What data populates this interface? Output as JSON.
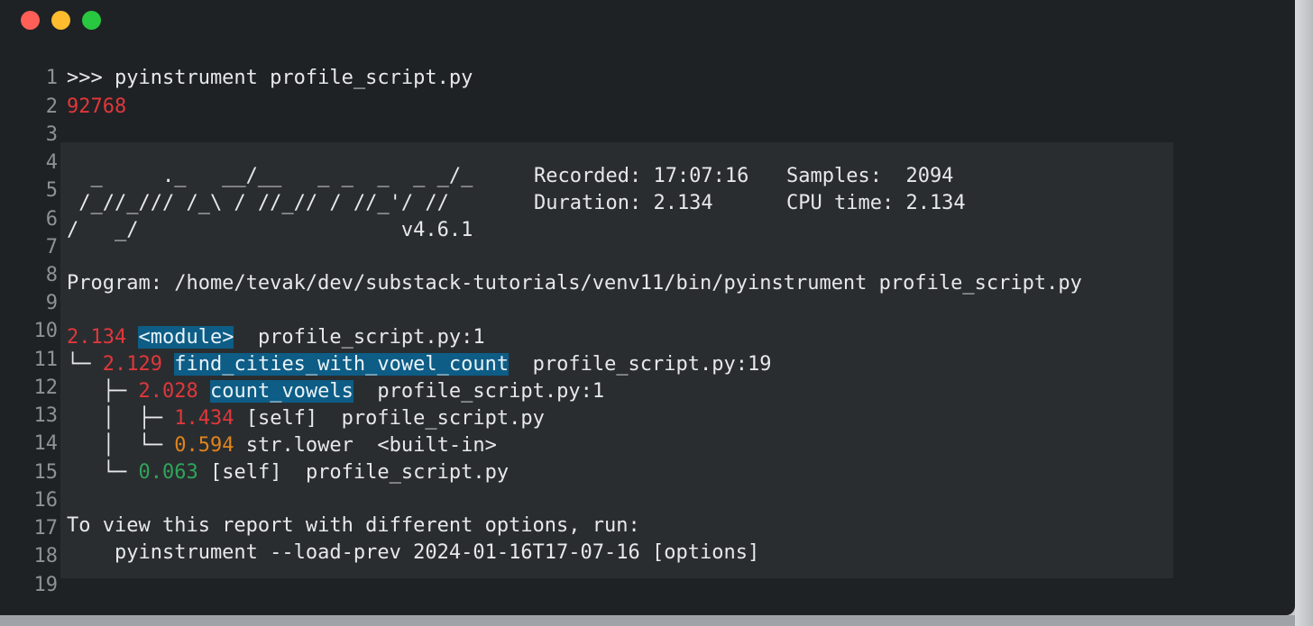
{
  "window": {
    "traffic_lights": [
      {
        "name": "close",
        "color": "#ff5f57"
      },
      {
        "name": "minimize",
        "color": "#febc2e"
      },
      {
        "name": "zoom",
        "color": "#28c840"
      }
    ],
    "background": "#1f2225",
    "block_background": "#2a2d30"
  },
  "colors": {
    "text": "#e6e8ea",
    "red": "#e0373b",
    "orange": "#e0841a",
    "green": "#2fa55a",
    "highlight": "#0d5d86",
    "line_number": "#8d9296"
  },
  "line_numbers": [
    "1",
    "2",
    "3",
    "4",
    "5",
    "6",
    "7",
    "8",
    "9",
    "10",
    "11",
    "12",
    "13",
    "14",
    "15",
    "16",
    "17",
    "18",
    "19"
  ],
  "terminal": {
    "command": ">>> pyinstrument profile_script.py",
    "pid": "92768",
    "logo_line1": "  _     ._   __/__   _ _  _  _ _/_",
    "logo_line2": " /_//_/// /_\\ / //_// / //_'/ //",
    "logo_line3": "/   _/                      v4.6.1",
    "recorded": "Recorded: 17:07:16",
    "samples": "Samples:  2094",
    "duration": "Duration: 2.134",
    "cpu_time": "CPU time: 2.134",
    "program": "Program: /home/tevak/dev/substack-tutorials/venv11/bin/pyinstrument profile_script.py",
    "tree": [
      {
        "prefix": "",
        "time": "2.134",
        "name": "<module>",
        "location": "  profile_script.py:1"
      },
      {
        "prefix": "└─ ",
        "time": "2.129",
        "name": "find_cities_with_vowel_count",
        "location": "  profile_script.py:19"
      },
      {
        "prefix": "   ├─ ",
        "time": "2.028",
        "name": "count_vowels",
        "location": "  profile_script.py:1"
      },
      {
        "prefix": "   │  ├─ ",
        "time": "1.434",
        "name": "[self]",
        "location": "  profile_script.py"
      },
      {
        "prefix": "   │  └─ ",
        "time": "0.594",
        "name": "str.lower",
        "location": "  <built-in>"
      },
      {
        "prefix": "   └─ ",
        "time": "0.063",
        "name": "[self]",
        "location": "  profile_script.py"
      }
    ],
    "footer_line1": "To view this report with different options, run:",
    "footer_line2": "    pyinstrument --load-prev 2024-01-16T17-07-16 [options]"
  }
}
